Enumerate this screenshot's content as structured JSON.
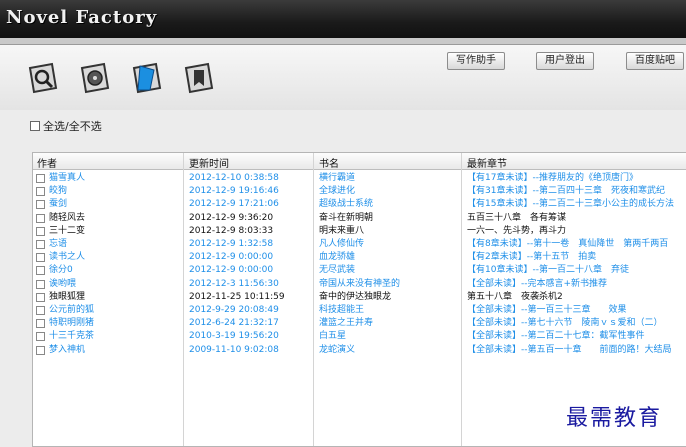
{
  "app": {
    "title": "Novel Factory"
  },
  "toolbar": {
    "buttons": [
      "写作助手",
      "用户登出",
      "百度贴吧"
    ],
    "tools": [
      "magnifier-icon",
      "film-reel-icon",
      "blue-flag-icon",
      "bookmark-arrow-icon"
    ]
  },
  "select_all_label": "全选/全不选",
  "table": {
    "columns": [
      "作者",
      "更新时间",
      "书名",
      "最新章节"
    ],
    "rows": [
      {
        "author": "猫雪真人",
        "time": "2012-12-10 0:38:58",
        "book": "横行霸道",
        "chapter": "【有17章未读】--推荐朋友的《绝顶唐门》",
        "unread": true
      },
      {
        "author": "皎狗",
        "time": "2012-12-9 19:16:46",
        "book": "全球进化",
        "chapter": "【有31章未读】--第二百四十三章　死夜和寒武纪",
        "unread": true
      },
      {
        "author": "蚕剑",
        "time": "2012-12-9 17:21:06",
        "book": "超级战士系统",
        "chapter": "【有15章未读】--第二百二十三章小公主的成长方法",
        "unread": true
      },
      {
        "author": "随轻风去",
        "time": "2012-12-9 9:36:20",
        "book": "奋斗在新明朝",
        "chapter": "五百三十八章　各有筹谋",
        "unread": false
      },
      {
        "author": "三十二变",
        "time": "2012-12-9 8:03:33",
        "book": "明末来重八",
        "chapter": "一六一、先斗势，再斗力",
        "unread": false
      },
      {
        "author": "忘语",
        "time": "2012-12-9 1:32:58",
        "book": "凡人修仙传",
        "chapter": "【有8章未读】--第十一卷　真仙降世　第两千两百",
        "unread": true
      },
      {
        "author": "读书之人",
        "time": "2012-12-9 0:00:00",
        "book": "血龙骄雄",
        "chapter": "【有2章未读】--第十五节　拍卖",
        "unread": true
      },
      {
        "author": "徐分0",
        "time": "2012-12-9 0:00:00",
        "book": "无尽武装",
        "chapter": "【有10章未读】--第一百二十八章　弃徒",
        "unread": true
      },
      {
        "author": "诶哟喂",
        "time": "2012-12-3 11:56:30",
        "book": "帝国从来没有神圣的",
        "chapter": "【全部未读】--完本感言+新书推荐",
        "unread": true
      },
      {
        "author": "独眼狐狸",
        "time": "2012-11-25 10:11:59",
        "book": "奋中的伊达独眼龙",
        "chapter": "第五十八章　夜袭杀机2",
        "unread": false
      },
      {
        "author": "公元前的狐",
        "time": "2012-9-29 20:08:49",
        "book": "科技超能王",
        "chapter": "【全部未读】--第一百三十三章　　效果",
        "unread": true
      },
      {
        "author": "特职明刚猪",
        "time": "2012-6-24 21:32:17",
        "book": "灌篮之王并寿",
        "chapter": "【全部未读】--第七十六节　陵南ｖｓ爱和（二）",
        "unread": true
      },
      {
        "author": "十三千克茶",
        "time": "2010-3-19 19:56:20",
        "book": "白五星",
        "chapter": "【全部未读】--第二百二十七章：截军性事件",
        "unread": true
      },
      {
        "author": "梦入神机",
        "time": "2009-11-10 9:02:08",
        "book": "龙蛇演义",
        "chapter": "【全部未读】--第五百一十章　　前面的路！大结局",
        "unread": true
      }
    ]
  },
  "colors": {
    "unread": "#1f8fe8",
    "read": "#111111"
  },
  "watermark": "最需教育"
}
